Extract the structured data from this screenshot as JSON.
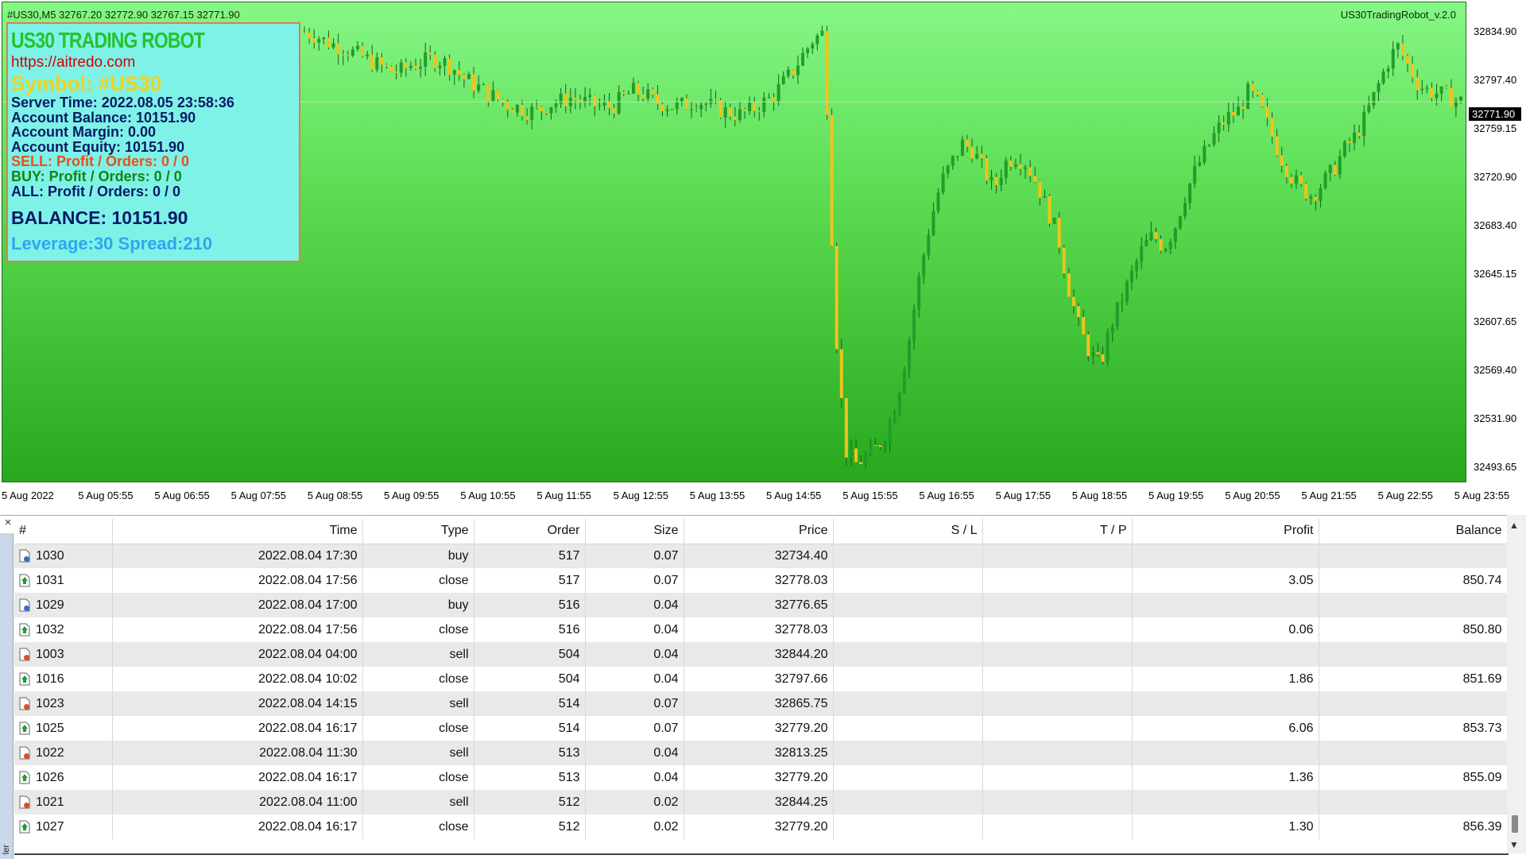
{
  "chart": {
    "header": "#US30,M5  32767.20 32772.90 32767.15 32771.90",
    "ea_name": "US30TradingRobot_v.2.0",
    "current_price": "32771.90",
    "price_ticks": [
      "32834.90",
      "32797.40",
      "32759.15",
      "32720.90",
      "32683.40",
      "32645.15",
      "32607.65",
      "32569.40",
      "32531.90",
      "32493.65"
    ],
    "time_ticks": [
      "5 Aug 2022",
      "5 Aug 05:55",
      "5 Aug 06:55",
      "5 Aug 07:55",
      "5 Aug 08:55",
      "5 Aug 09:55",
      "5 Aug 10:55",
      "5 Aug 11:55",
      "5 Aug 12:55",
      "5 Aug 13:55",
      "5 Aug 14:55",
      "5 Aug 15:55",
      "5 Aug 16:55",
      "5 Aug 17:55",
      "5 Aug 18:55",
      "5 Aug 19:55",
      "5 Aug 20:55",
      "5 Aug 21:55",
      "5 Aug 22:55",
      "5 Aug 23:55"
    ],
    "colors": {
      "bull": "#1f9e2a",
      "bear": "#f2c21b",
      "bg_top": "#86f786",
      "bg_bottom": "#28a81c"
    }
  },
  "chart_data": {
    "type": "candlestick",
    "symbol": "#US30",
    "timeframe": "M5",
    "ylim": [
      32480,
      32848
    ],
    "x_range": [
      "5 Aug 2022 04:55",
      "5 Aug 23:55"
    ],
    "close_path": [
      32825,
      32823,
      32818,
      32815,
      32812,
      32808,
      32804,
      32800,
      32796,
      32795,
      32800,
      32802,
      32805,
      32803,
      32798,
      32790,
      32785,
      32780,
      32775,
      32770,
      32768,
      32765,
      32765,
      32770,
      32772,
      32775,
      32773,
      32770,
      32768,
      32768,
      32775,
      32780,
      32778,
      32772,
      32770,
      32768,
      32770,
      32773,
      32770,
      32766,
      32764,
      32762,
      32765,
      32770,
      32775,
      32785,
      32795,
      32808,
      32820,
      32825,
      32605,
      32505,
      32495,
      32500,
      32508,
      32520,
      32550,
      32590,
      32640,
      32680,
      32710,
      32725,
      32740,
      32735,
      32720,
      32705,
      32725,
      32730,
      32725,
      32710,
      32690,
      32670,
      32630,
      32600,
      32580,
      32570,
      32600,
      32620,
      32640,
      32660,
      32670,
      32660,
      32675,
      32700,
      32720,
      32735,
      32750,
      32760,
      32765,
      32780,
      32770,
      32750,
      32730,
      32715,
      32705,
      32700,
      32710,
      32720,
      32735,
      32745,
      32760,
      32780,
      32800,
      32815,
      32800,
      32785,
      32780,
      32778,
      32775,
      32772
    ]
  },
  "info_panel": {
    "title": "US30 TRADING ROBOT",
    "url": "https://aitredo.com",
    "symbol": "Symbol: #US30",
    "server_time": "Server Time: 2022.08.05 23:58:36",
    "account_balance": "Account Balance: 10151.90",
    "account_margin": "Account Margin: 0.00",
    "account_equity": "Account Equity: 10151.90",
    "sell": "SELL: Profit / Orders: 0  /  0",
    "buy": "BUY:  Profit / Orders: 0  /  0",
    "all": "ALL:  Profit / Orders:  0  /  0",
    "balance": "BALANCE: 10151.90",
    "leverage_spread": "Leverage:30  Spread:210"
  },
  "terminal": {
    "close_glyph": "×",
    "side_label": "ler",
    "columns": [
      "#",
      "Time",
      "Type",
      "Order",
      "Size",
      "Price",
      "S / L",
      "T / P",
      "Profit",
      "Balance"
    ],
    "rows": [
      {
        "id": "1030",
        "time": "2022.08.04 17:30",
        "type": "buy",
        "order": "517",
        "size": "0.07",
        "price": "32734.40",
        "sl": "",
        "tp": "",
        "profit": "",
        "balance": "",
        "icon": "buy"
      },
      {
        "id": "1031",
        "time": "2022.08.04 17:56",
        "type": "close",
        "order": "517",
        "size": "0.07",
        "price": "32778.03",
        "sl": "",
        "tp": "",
        "profit": "3.05",
        "balance": "850.74",
        "icon": "close"
      },
      {
        "id": "1029",
        "time": "2022.08.04 17:00",
        "type": "buy",
        "order": "516",
        "size": "0.04",
        "price": "32776.65",
        "sl": "",
        "tp": "",
        "profit": "",
        "balance": "",
        "icon": "buy"
      },
      {
        "id": "1032",
        "time": "2022.08.04 17:56",
        "type": "close",
        "order": "516",
        "size": "0.04",
        "price": "32778.03",
        "sl": "",
        "tp": "",
        "profit": "0.06",
        "balance": "850.80",
        "icon": "close"
      },
      {
        "id": "1003",
        "time": "2022.08.04 04:00",
        "type": "sell",
        "order": "504",
        "size": "0.04",
        "price": "32844.20",
        "sl": "",
        "tp": "",
        "profit": "",
        "balance": "",
        "icon": "sell"
      },
      {
        "id": "1016",
        "time": "2022.08.04 10:02",
        "type": "close",
        "order": "504",
        "size": "0.04",
        "price": "32797.66",
        "sl": "",
        "tp": "",
        "profit": "1.86",
        "balance": "851.69",
        "icon": "close"
      },
      {
        "id": "1023",
        "time": "2022.08.04 14:15",
        "type": "sell",
        "order": "514",
        "size": "0.07",
        "price": "32865.75",
        "sl": "",
        "tp": "",
        "profit": "",
        "balance": "",
        "icon": "sell"
      },
      {
        "id": "1025",
        "time": "2022.08.04 16:17",
        "type": "close",
        "order": "514",
        "size": "0.07",
        "price": "32779.20",
        "sl": "",
        "tp": "",
        "profit": "6.06",
        "balance": "853.73",
        "icon": "close"
      },
      {
        "id": "1022",
        "time": "2022.08.04 11:30",
        "type": "sell",
        "order": "513",
        "size": "0.04",
        "price": "32813.25",
        "sl": "",
        "tp": "",
        "profit": "",
        "balance": "",
        "icon": "sell"
      },
      {
        "id": "1026",
        "time": "2022.08.04 16:17",
        "type": "close",
        "order": "513",
        "size": "0.04",
        "price": "32779.20",
        "sl": "",
        "tp": "",
        "profit": "1.36",
        "balance": "855.09",
        "icon": "close"
      },
      {
        "id": "1021",
        "time": "2022.08.04 11:00",
        "type": "sell",
        "order": "512",
        "size": "0.02",
        "price": "32844.25",
        "sl": "",
        "tp": "",
        "profit": "",
        "balance": "",
        "icon": "sell"
      },
      {
        "id": "1027",
        "time": "2022.08.04 16:17",
        "type": "close",
        "order": "512",
        "size": "0.02",
        "price": "32779.20",
        "sl": "",
        "tp": "",
        "profit": "1.30",
        "balance": "856.39",
        "icon": "close"
      }
    ],
    "icon_colors": {
      "buy": "#2f6fd0",
      "sell": "#d9502a",
      "close": "#1f9e2a"
    }
  }
}
